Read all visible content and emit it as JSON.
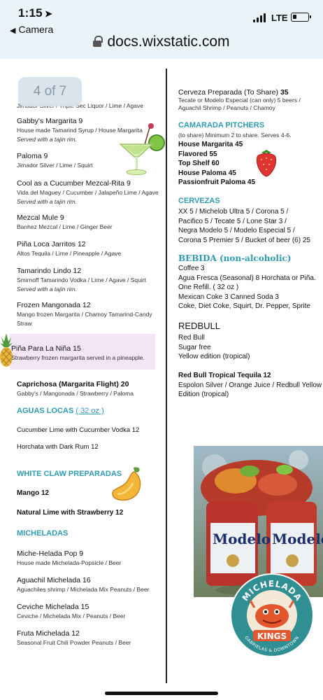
{
  "status_bar": {
    "time": "1:15",
    "back_label": "Camera",
    "network": "LTE"
  },
  "address_bar": {
    "url": "docs.wixstatic.com"
  },
  "page_indicator": "4 of 7",
  "left_column": {
    "partial_line": "Jimador Silver / Triple Sec Liquor / Lime / Agave",
    "items": [
      {
        "name": "Gabby's Margarita 9",
        "desc": "House made Tamarind Syrup / House Margarita",
        "note": "Served with a tajin rim."
      },
      {
        "name": "Paloma 9",
        "desc": "Jimador Silver / Lime / Squirt"
      },
      {
        "name": "Cool as a Cucumber Mezcal-Rita 9",
        "desc": "Vida del Maguey / Cucumber / Jalapeño Lime / Agave",
        "note": "Served with a tajin rim."
      },
      {
        "name": "Mezcal Mule 9",
        "desc": "Banhez Mezcal / Lime / Ginger Beer"
      },
      {
        "name": "Piña Loca Jarritos 12",
        "desc": "Altos Tequila / Lime / Pineapple / Agave"
      },
      {
        "name": "Tamarindo Lindo 12",
        "desc": "Smirnoff Tamarindo Vodka / Lime / Agave / Squirt",
        "note": "Served with a tajin rim."
      },
      {
        "name": "Frozen Mangonada 12",
        "desc": "Mango frozen Margarita / Chamoy Tamarind-Candy",
        "desc2": "Straw"
      },
      {
        "name": "Piña Para La Niña 15",
        "desc": "Strawberry frozen margarita served in a pineapple."
      },
      {
        "name": "Caprichosa (Margarita Flight) 20",
        "desc": "Gabby's / Mangonada / Strawberry / Paloma"
      }
    ],
    "aguas_locas": {
      "title": "AGUAS LOCAS",
      "title_suffix": "( 32 oz )",
      "items": [
        "Cucumber Lime with Cucumber Vodka 12",
        "Horchata with Dark Rum 12"
      ]
    },
    "white_claw": {
      "title": "WHITE CLAW PREPARADAS",
      "items": [
        "Mango 12",
        "Natural Lime with Strawberry 12"
      ]
    },
    "micheladas": {
      "title": "MICHELADAS",
      "items": [
        {
          "name": "Miche-Helada Pop 9",
          "desc": "House made Michelada-Popsicle / Beer"
        },
        {
          "name": "Aguachil Michelada 16",
          "desc": "Aguachiles shrimp / Michelada Mix Peanuts / Beer"
        },
        {
          "name": "Ceviche Michelada 15",
          "desc": "Ceviche / Michelada Mix / Peanuts / Beer"
        },
        {
          "name": "Fruta Michelada 12",
          "desc": "Seasonal Fruit Chili Powder Peanuts / Beer"
        }
      ]
    }
  },
  "right_column": {
    "cerveza_preparada": {
      "name": "Cerveza Preparada",
      "qualifier": "(To Share)",
      "price": "35",
      "desc1": "Tecate or Modelo Especial (can only) 5 beers /",
      "desc2": "Aguachil Shrimp / Peanuts / Chamoy"
    },
    "camarada": {
      "title": "CAMARADA PITCHERS",
      "note": "(to share) Minimum 2 to share. Serves 4-6.",
      "items": [
        "House Margarita 45",
        "Flavored 55",
        "Top Shelf 60",
        "House Paloma 45",
        "Passionfruit Paloma 45"
      ]
    },
    "cervezas": {
      "title": "CERVEZAS",
      "lines": [
        "XX 5 / Michelob Ultra 5 / Corona 5 /",
        "Pacifico 5 / Tecate 5 / Lone Star 3 /",
        "Negra Modelo 5 / Modelo Especial 5 /",
        "Corona 5 Premier 5 / Bucket of beer (6) 25"
      ]
    },
    "bebida": {
      "title": "BEBIDA (non-alcoholic)",
      "lines": [
        "Coffee 3",
        "Agua Fresca (Seasonal) 8 Horchata or Piña.",
        "One Refill. ( 32 oz )",
        "Mexican Coke 3  Canned Soda 3",
        "Coke, Diet Coke, Squirt, Dr. Pepper, Sprite"
      ]
    },
    "redbull": {
      "title": "REDBULL",
      "lines": [
        "Red Bull",
        "Sugar free",
        "Yellow edition (tropical)"
      ],
      "tropical": {
        "name": "Red Bull Tropical Tequila 12",
        "lines": [
          "Espolon Silver / Orange Juice / Redbull Yellow",
          "Edition (tropical)"
        ]
      }
    },
    "photo_can_text": "Modelo",
    "logo": {
      "top": "MICHELADA",
      "bottom": "KINGS",
      "sub": "GABRIELAS & DOWNTOWN"
    }
  },
  "colors": {
    "section_teal": "#2e9bb0",
    "highlight_pink": "#f2e6f6",
    "status_bar_bg": "#e9f3f8"
  }
}
